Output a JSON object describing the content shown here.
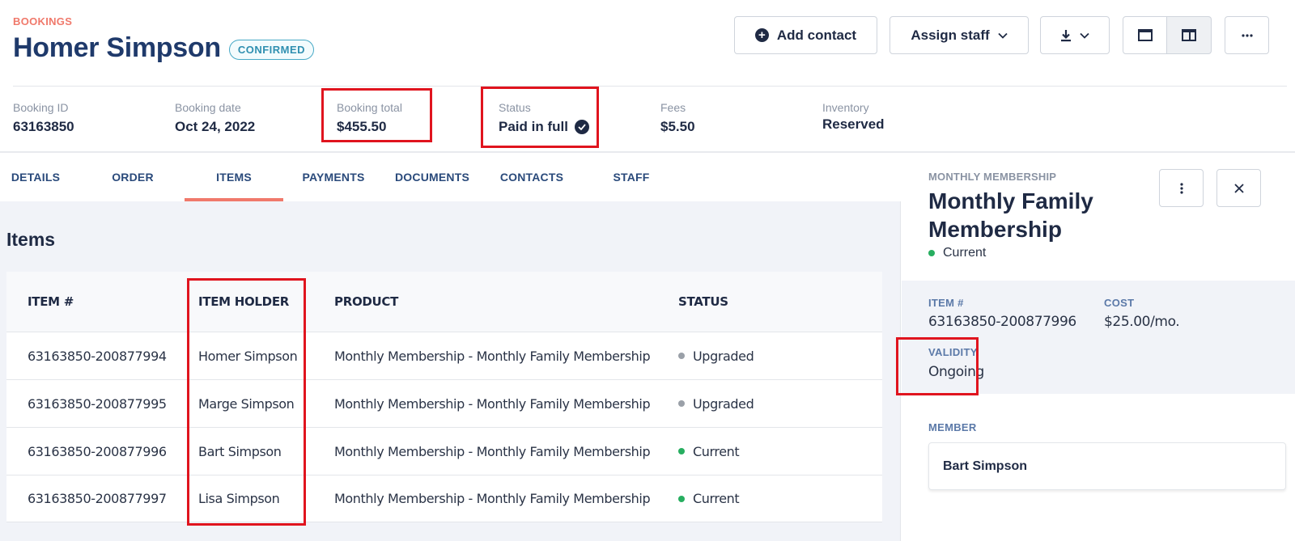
{
  "header": {
    "eyebrow": "BOOKINGS",
    "title": "Homer Simpson",
    "badge": "CONFIRMED",
    "add_contact_label": "Add contact",
    "assign_staff_label": "Assign staff",
    "more_label": "···"
  },
  "summary": {
    "booking_id": {
      "label": "Booking ID",
      "value": "63163850"
    },
    "booking_date": {
      "label": "Booking date",
      "value": "Oct 24, 2022"
    },
    "booking_total": {
      "label": "Booking total",
      "value": "$455.50"
    },
    "status": {
      "label": "Status",
      "value": "Paid in full"
    },
    "fees": {
      "label": "Fees",
      "value": "$5.50"
    },
    "inventory": {
      "label": "Inventory",
      "value": "Reserved"
    }
  },
  "tabs": [
    {
      "label": "DETAILS"
    },
    {
      "label": "ORDER"
    },
    {
      "label": "ITEMS",
      "active": true
    },
    {
      "label": "PAYMENTS"
    },
    {
      "label": "DOCUMENTS"
    },
    {
      "label": "CONTACTS"
    },
    {
      "label": "STAFF"
    }
  ],
  "items": {
    "title": "Items",
    "columns": [
      "ITEM #",
      "ITEM HOLDER",
      "PRODUCT",
      "STATUS"
    ],
    "rows": [
      {
        "item": "63163850-200877994",
        "holder": "Homer Simpson",
        "product": "Monthly Membership - Monthly Family Membership",
        "status": "Upgraded"
      },
      {
        "item": "63163850-200877995",
        "holder": "Marge Simpson",
        "product": "Monthly Membership - Monthly Family Membership",
        "status": "Upgraded"
      },
      {
        "item": "63163850-200877996",
        "holder": "Bart Simpson",
        "product": "Monthly Membership - Monthly Family Membership",
        "status": "Current"
      },
      {
        "item": "63163850-200877997",
        "holder": "Lisa Simpson",
        "product": "Monthly Membership - Monthly Family Membership",
        "status": "Current"
      }
    ]
  },
  "side_panel": {
    "eyebrow": "MONTHLY MEMBERSHIP",
    "title": "Monthly Family Membership",
    "status": "Current",
    "item_label": "ITEM #",
    "item_value": "63163850-200877996",
    "cost_label": "COST",
    "cost_value": "$25.00/mo.",
    "validity_label": "VALIDITY",
    "validity_value": "Ongoing",
    "member_label": "MEMBER",
    "member_value": "Bart Simpson"
  },
  "colors": {
    "accent": "#f0796b",
    "primary_text": "#1f3a6b",
    "badge": "#47a9c6",
    "status_current": "#27ae60",
    "status_upgraded": "#9aa0a8",
    "highlight": "#e0141e"
  },
  "icons": {
    "add_contact": "plus-circle-icon",
    "dropdown": "chevron-down-icon",
    "download": "download-icon",
    "layout_single": "single-panel-icon",
    "layout_split": "split-panel-icon",
    "more": "more-horizontal-icon",
    "paid": "check-circle-icon",
    "kebab": "more-vertical-icon",
    "close": "close-icon"
  }
}
